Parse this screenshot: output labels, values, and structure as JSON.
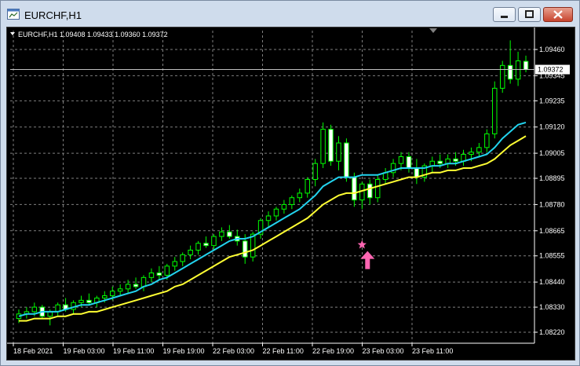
{
  "window": {
    "title": "EURCHF,H1",
    "buttons": [
      "minimize",
      "maximize",
      "close"
    ]
  },
  "chart_header": {
    "symbol_label": "EURCHF,H1  1.09408 1.09433 1.09360 1.09372"
  },
  "colors": {
    "background": "#000000",
    "grid": "#7f7f7f",
    "candle_up_fill": "#000000",
    "candle_down_fill": "#ffffff",
    "candle_outline": "#00ff00",
    "ma_fast": "#22d3ee",
    "ma_slow": "#ffff33",
    "signal_star": "#ff66b3",
    "signal_arrow": "#ff66b3",
    "price_line": "#c0c0c0"
  },
  "chart_data": {
    "type": "candlestick",
    "symbol": "EURCHF",
    "timeframe": "H1",
    "ohlc_current": {
      "open": 1.09408,
      "high": 1.09433,
      "low": 1.0936,
      "close": 1.09372
    },
    "current_price_label": "1.09372",
    "y_tick_labels": [
      "1.09460",
      "1.09345",
      "1.09235",
      "1.09120",
      "1.09005",
      "1.08895",
      "1.08780",
      "1.08665",
      "1.08555",
      "1.08440",
      "1.08330",
      "1.08220"
    ],
    "ylim": [
      1.0822,
      1.0946
    ],
    "x_tick_labels": [
      "18 Feb 2021",
      "19 Feb 03:00",
      "19 Feb 11:00",
      "19 Feb 19:00",
      "22 Feb 03:00",
      "22 Feb 11:00",
      "22 Feb 19:00",
      "23 Feb 03:00",
      "23 Feb 11:00"
    ],
    "grid": true,
    "candles": [
      [
        1.0828,
        1.0832,
        1.0826,
        1.083
      ],
      [
        1.083,
        1.0833,
        1.0828,
        1.0831
      ],
      [
        1.0831,
        1.0835,
        1.0829,
        1.0833
      ],
      [
        1.0833,
        1.0834,
        1.0828,
        1.0829
      ],
      [
        1.0829,
        1.0832,
        1.0825,
        1.0831
      ],
      [
        1.0831,
        1.0835,
        1.0829,
        1.0834
      ],
      [
        1.0834,
        1.0837,
        1.0831,
        1.0832
      ],
      [
        1.0832,
        1.0836,
        1.083,
        1.0835
      ],
      [
        1.0835,
        1.0838,
        1.0833,
        1.0836
      ],
      [
        1.0836,
        1.0839,
        1.0834,
        1.0835
      ],
      [
        1.0835,
        1.0838,
        1.0833,
        1.0837
      ],
      [
        1.0837,
        1.084,
        1.0835,
        1.0838
      ],
      [
        1.0838,
        1.0842,
        1.0836,
        1.084
      ],
      [
        1.084,
        1.0843,
        1.0838,
        1.0841
      ],
      [
        1.0841,
        1.0845,
        1.0839,
        1.0843
      ],
      [
        1.0843,
        1.0846,
        1.0841,
        1.0842
      ],
      [
        1.0842,
        1.0847,
        1.084,
        1.0846
      ],
      [
        1.0846,
        1.085,
        1.0844,
        1.0848
      ],
      [
        1.0848,
        1.0851,
        1.0845,
        1.0847
      ],
      [
        1.0847,
        1.0852,
        1.0845,
        1.0851
      ],
      [
        1.0851,
        1.0855,
        1.0849,
        1.0853
      ],
      [
        1.0853,
        1.0857,
        1.0851,
        1.0856
      ],
      [
        1.0856,
        1.086,
        1.0854,
        1.0858
      ],
      [
        1.0858,
        1.0862,
        1.0856,
        1.0861
      ],
      [
        1.0861,
        1.0864,
        1.0859,
        1.086
      ],
      [
        1.086,
        1.0865,
        1.0858,
        1.0864
      ],
      [
        1.0864,
        1.0868,
        1.0862,
        1.0866
      ],
      [
        1.0866,
        1.0869,
        1.0863,
        1.0864
      ],
      [
        1.0864,
        1.0867,
        1.086,
        1.0862
      ],
      [
        1.0862,
        1.0865,
        1.0852,
        1.0855
      ],
      [
        1.0855,
        1.0866,
        1.0853,
        1.0865
      ],
      [
        1.0865,
        1.0872,
        1.0863,
        1.0871
      ],
      [
        1.0871,
        1.0875,
        1.0868,
        1.0873
      ],
      [
        1.0873,
        1.0877,
        1.0871,
        1.0876
      ],
      [
        1.0876,
        1.088,
        1.0874,
        1.0878
      ],
      [
        1.0878,
        1.0882,
        1.0876,
        1.0881
      ],
      [
        1.0881,
        1.0885,
        1.0879,
        1.0883
      ],
      [
        1.0883,
        1.089,
        1.0881,
        1.0889
      ],
      [
        1.0889,
        1.0898,
        1.0886,
        1.0896
      ],
      [
        1.0896,
        1.0914,
        1.0894,
        1.0911
      ],
      [
        1.0911,
        1.0913,
        1.0895,
        1.0897
      ],
      [
        1.0897,
        1.0908,
        1.0893,
        1.0905
      ],
      [
        1.0905,
        1.0907,
        1.0888,
        1.089
      ],
      [
        1.089,
        1.0892,
        1.0877,
        1.088
      ],
      [
        1.088,
        1.0888,
        1.0876,
        1.0887
      ],
      [
        1.0887,
        1.0889,
        1.0878,
        1.0881
      ],
      [
        1.0881,
        1.0891,
        1.0879,
        1.0889
      ],
      [
        1.0889,
        1.0894,
        1.0887,
        1.0892
      ],
      [
        1.0892,
        1.0898,
        1.089,
        1.0896
      ],
      [
        1.0896,
        1.0901,
        1.0893,
        1.0899
      ],
      [
        1.0899,
        1.0901,
        1.0892,
        1.0894
      ],
      [
        1.0894,
        1.0898,
        1.0887,
        1.089
      ],
      [
        1.089,
        1.0896,
        1.0888,
        1.0895
      ],
      [
        1.0895,
        1.0899,
        1.0892,
        1.0897
      ],
      [
        1.0897,
        1.09,
        1.0894,
        1.0896
      ],
      [
        1.0896,
        1.09,
        1.0894,
        1.0898
      ],
      [
        1.0898,
        1.0901,
        1.0895,
        1.0897
      ],
      [
        1.0897,
        1.0902,
        1.0895,
        1.09
      ],
      [
        1.09,
        1.0903,
        1.0897,
        1.0901
      ],
      [
        1.0901,
        1.0905,
        1.0899,
        1.0903
      ],
      [
        1.0903,
        1.0911,
        1.0901,
        1.0909
      ],
      [
        1.0909,
        1.0932,
        1.0907,
        1.0929
      ],
      [
        1.0929,
        1.0941,
        1.0927,
        1.0939
      ],
      [
        1.0939,
        1.095,
        1.0931,
        1.0933
      ],
      [
        1.0933,
        1.0945,
        1.093,
        1.0941
      ],
      [
        1.09408,
        1.09433,
        1.0936,
        1.09372
      ]
    ],
    "ma_fast": [
      1.0829,
      1.083,
      1.083,
      1.0831,
      1.0831,
      1.0831,
      1.0832,
      1.0833,
      1.0834,
      1.0834,
      1.0835,
      1.0836,
      1.0837,
      1.0838,
      1.0839,
      1.084,
      1.0842,
      1.0843,
      1.0845,
      1.0846,
      1.0848,
      1.085,
      1.0852,
      1.0854,
      1.0856,
      1.0858,
      1.086,
      1.0862,
      1.0863,
      1.0863,
      1.0864,
      1.0866,
      1.0868,
      1.087,
      1.0872,
      1.0874,
      1.0876,
      1.0879,
      1.0882,
      1.0886,
      1.0888,
      1.089,
      1.089,
      1.089,
      1.0891,
      1.0891,
      1.0891,
      1.0892,
      1.0893,
      1.0894,
      1.0894,
      1.0894,
      1.0894,
      1.0895,
      1.0895,
      1.0896,
      1.0896,
      1.0897,
      1.0898,
      1.0899,
      1.09,
      1.0903,
      1.0907,
      1.091,
      1.0913,
      1.0914
    ],
    "ma_slow": [
      1.0827,
      1.0827,
      1.0828,
      1.0828,
      1.0828,
      1.0829,
      1.0829,
      1.083,
      1.083,
      1.0831,
      1.0831,
      1.0832,
      1.0833,
      1.0834,
      1.0835,
      1.0836,
      1.0837,
      1.0838,
      1.0839,
      1.084,
      1.0842,
      1.0843,
      1.0845,
      1.0847,
      1.0849,
      1.0851,
      1.0853,
      1.0855,
      1.0856,
      1.0857,
      1.0858,
      1.086,
      1.0862,
      1.0864,
      1.0866,
      1.0868,
      1.087,
      1.0872,
      1.0875,
      1.0878,
      1.088,
      1.0882,
      1.0883,
      1.0883,
      1.0884,
      1.0885,
      1.0886,
      1.0887,
      1.0888,
      1.0889,
      1.089,
      1.089,
      1.0891,
      1.0892,
      1.0892,
      1.0893,
      1.0893,
      1.0894,
      1.0894,
      1.0895,
      1.0896,
      1.0898,
      1.0901,
      1.0904,
      1.0906,
      1.0908
    ],
    "signal": {
      "candle_index": 44,
      "price": 1.087,
      "markers": [
        "star",
        "up-arrow"
      ]
    }
  }
}
